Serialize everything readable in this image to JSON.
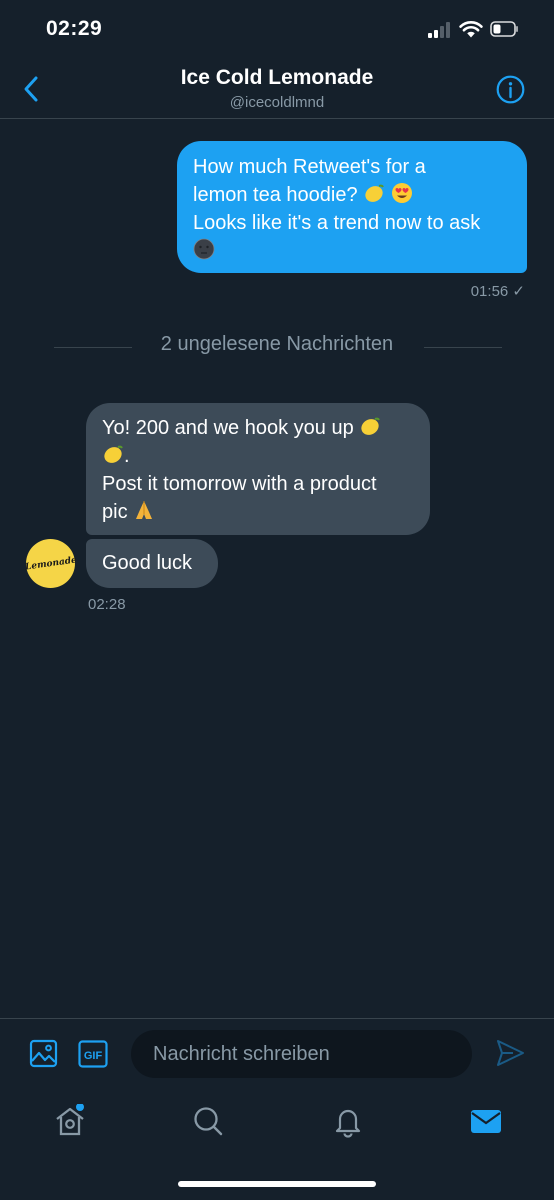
{
  "status_bar": {
    "time": "02:29"
  },
  "header": {
    "title": "Ice Cold Lemonade",
    "handle": "@icecoldlmnd"
  },
  "messages": {
    "sent": {
      "line1": "How much Retweet's for a",
      "line2": "lemon tea hoodie?",
      "line3": "Looks like it's a trend now to ask",
      "time": "01:56 ✓"
    },
    "unread_divider": "2 ungelesene Nachrichten",
    "received1": {
      "line1": "Yo! 200 and we hook you up",
      "line2": ".",
      "line3": "Post it tomorrow with a product",
      "line4": "pic"
    },
    "received2": {
      "text": "Good luck",
      "time": "02:28"
    },
    "avatar_text": "Lemonade"
  },
  "composer": {
    "placeholder": "Nachricht schreiben",
    "gif_label": "GIF"
  },
  "icons": {
    "back": "chevron-left-icon",
    "info": "info-icon",
    "image": "image-icon",
    "gif": "gif-icon",
    "send": "send-icon",
    "home": "home-icon",
    "search": "search-icon",
    "notifications": "bell-icon",
    "messages": "mail-icon"
  },
  "colors": {
    "background": "#15202b",
    "accent": "#1da1f2",
    "received_bubble": "#3d4b58",
    "muted_text": "#8899a6"
  }
}
